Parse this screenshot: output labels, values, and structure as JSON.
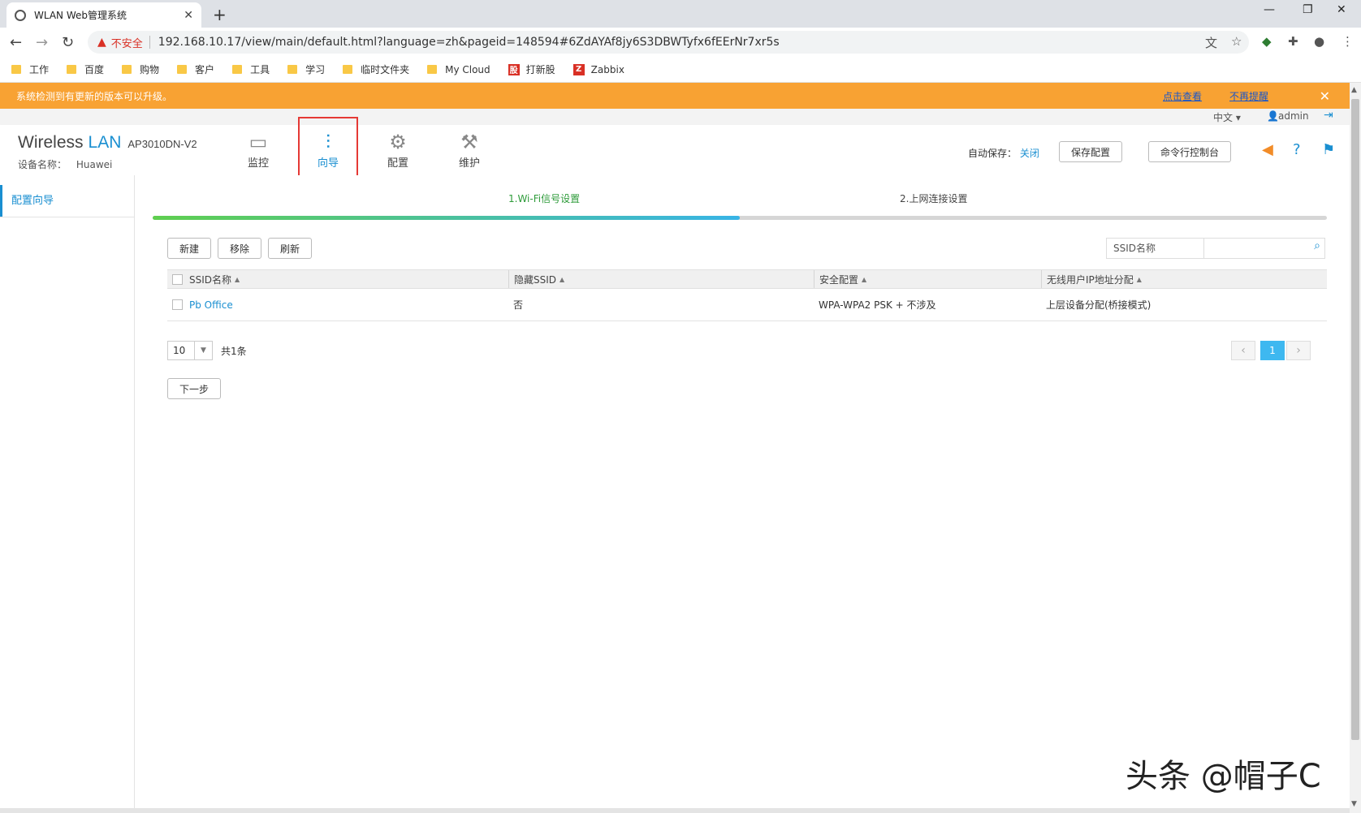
{
  "browser": {
    "tab_title": "WLAN Web管理系统",
    "tab_close": "✕",
    "new_tab": "+",
    "insecure_label": "不安全",
    "url": "192.168.10.17/view/main/default.html?language=zh&pageid=148594#6ZdAYAf8jy6S3DBWTyfx6fEErNr7xr5s",
    "bookmarks": [
      "工作",
      "百度",
      "购物",
      "客户",
      "工具",
      "学习",
      "临时文件夹",
      "My Cloud"
    ],
    "bookmark_dxg": "打新股",
    "bookmark_zabbix": "Zabbix"
  },
  "banner": {
    "message": "系统检测到有更新的版本可以升级。",
    "view_link": "点击查看",
    "dismiss_link": "不再提醒",
    "close": "✕"
  },
  "header": {
    "language": "中文 ▾",
    "user": "admin",
    "brand_wireless": "Wireless",
    "brand_lan": "LAN",
    "model": "AP3010DN-V2",
    "device_label": "设备名称：",
    "device_name": "Huawei",
    "nav": [
      {
        "label": "监控"
      },
      {
        "label": "向导"
      },
      {
        "label": "配置"
      },
      {
        "label": "维护"
      }
    ],
    "autosave_label": "自动保存：",
    "autosave_value": "关闭",
    "save_config": "保存配置",
    "cli_console": "命令行控制台"
  },
  "sidebar": {
    "items": [
      {
        "label": "配置向导"
      }
    ]
  },
  "wizard": {
    "steps": [
      "1.Wi-Fi信号设置",
      "2.上网连接设置"
    ],
    "progress": 0.5,
    "buttons": {
      "new": "新建",
      "remove": "移除",
      "refresh": "刷新"
    },
    "search_label": "SSID名称",
    "search_placeholder": "",
    "columns": [
      "SSID名称",
      "隐藏SSID",
      "安全配置",
      "无线用户IP地址分配"
    ],
    "rows": [
      {
        "ssid": "Pb Office",
        "hidden": "否",
        "security": "WPA-WPA2 PSK + 不涉及",
        "ip_assign": "上层设备分配(桥接模式)"
      }
    ],
    "page_size": "10",
    "total": "共1条",
    "current_page": "1",
    "next_step": "下一步"
  },
  "watermark": "头条 @帽子C",
  "colors": {
    "accent": "#1a8fd1",
    "banner": "#f8a233",
    "highlight": "#e53935"
  }
}
